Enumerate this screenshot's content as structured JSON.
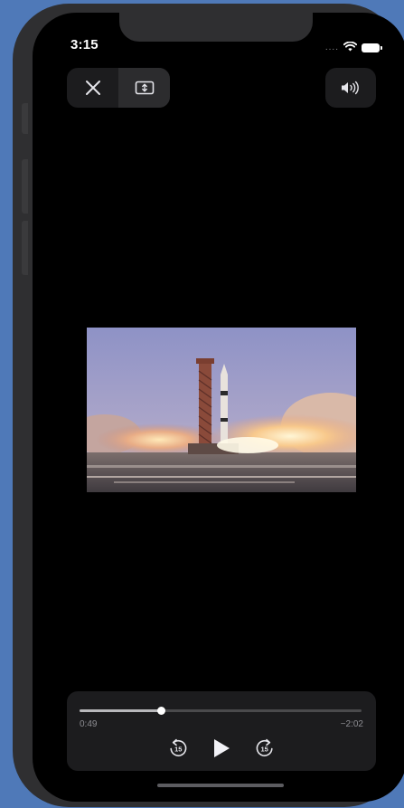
{
  "status_bar": {
    "time": "3:15",
    "signal": "....",
    "icons": [
      "wifi-icon",
      "battery-icon"
    ]
  },
  "top_controls": {
    "close_icon": "close-icon",
    "resize_icon": "resize-icon",
    "volume_icon": "speaker-icon"
  },
  "video": {
    "scene": "rocket-launch-thumbnail"
  },
  "player": {
    "elapsed": "0:49",
    "remaining": "−2:02",
    "progress": 0.29,
    "skip_back_seconds": "15",
    "skip_forward_seconds": "15",
    "play_icon": "play-icon"
  },
  "colors": {
    "background": "#4f79b8",
    "screen": "#000000",
    "control_bg": "#1c1c1e"
  }
}
